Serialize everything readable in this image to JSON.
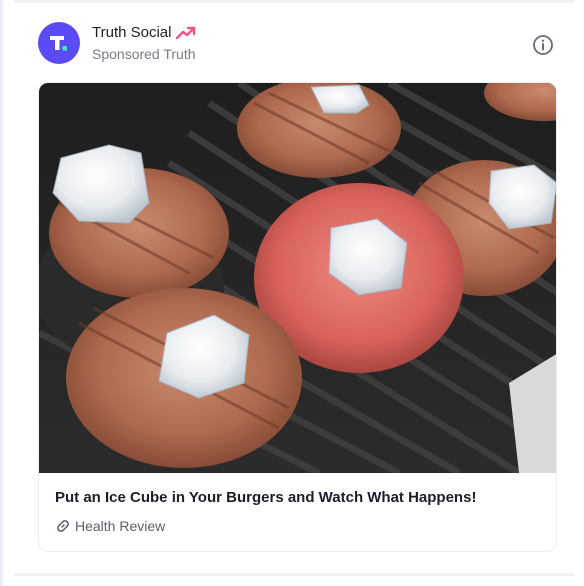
{
  "post": {
    "account_name": "Truth Social",
    "account_subtitle": "Sponsored Truth",
    "avatar_icon": "truth-social-logo-icon",
    "trending_icon": "trending-up-icon",
    "info_icon": "info-circle-icon"
  },
  "ad": {
    "title": "Put an Ice Cube in Your Burgers and Watch What Happens!",
    "source": "Health Review",
    "source_icon": "link-icon",
    "image_subject": "grilled burger patties with ice cubes"
  },
  "colors": {
    "accent": "#5b4bf5",
    "trending": "#f0568a",
    "text_primary": "#1d1d2b",
    "text_secondary": "#7a7a88"
  }
}
